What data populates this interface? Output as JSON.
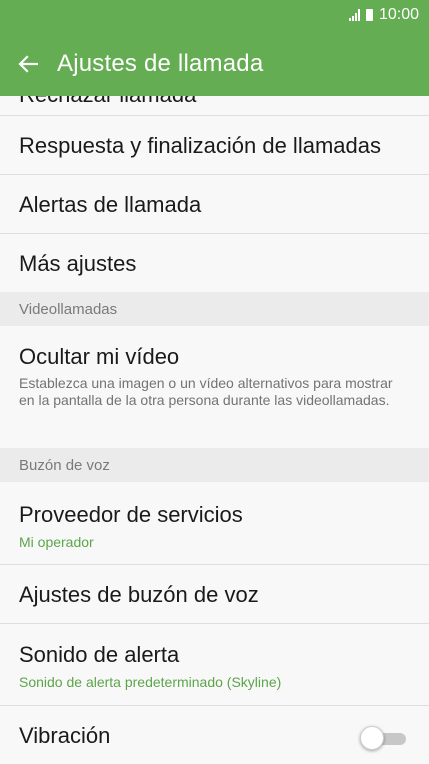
{
  "status_bar": {
    "time": "10:00"
  },
  "header": {
    "title": "Ajustes de llamada"
  },
  "items": {
    "partial_label": "Rechazar llamada",
    "respuesta": "Respuesta y finalización de llamadas",
    "alertas": "Alertas de llamada",
    "mas_ajustes": "Más ajustes",
    "section_video": "Videollamadas",
    "ocultar": "Ocultar mi vídeo",
    "ocultar_desc": "Establezca una imagen o un vídeo alternativos para mostrar en la pantalla de la otra persona durante las videollamadas.",
    "section_buzon": "Buzón de voz",
    "proveedor": "Proveedor de servicios",
    "proveedor_value": "Mi operador",
    "ajustes_buzon": "Ajustes de buzón de voz",
    "sonido": "Sonido de alerta",
    "sonido_value": "Sonido de alerta predeterminado (Skyline)",
    "vibracion": "Vibración",
    "vibracion_on": false
  },
  "colors": {
    "accent": "#64ad53",
    "summary": "#5ca54a"
  }
}
